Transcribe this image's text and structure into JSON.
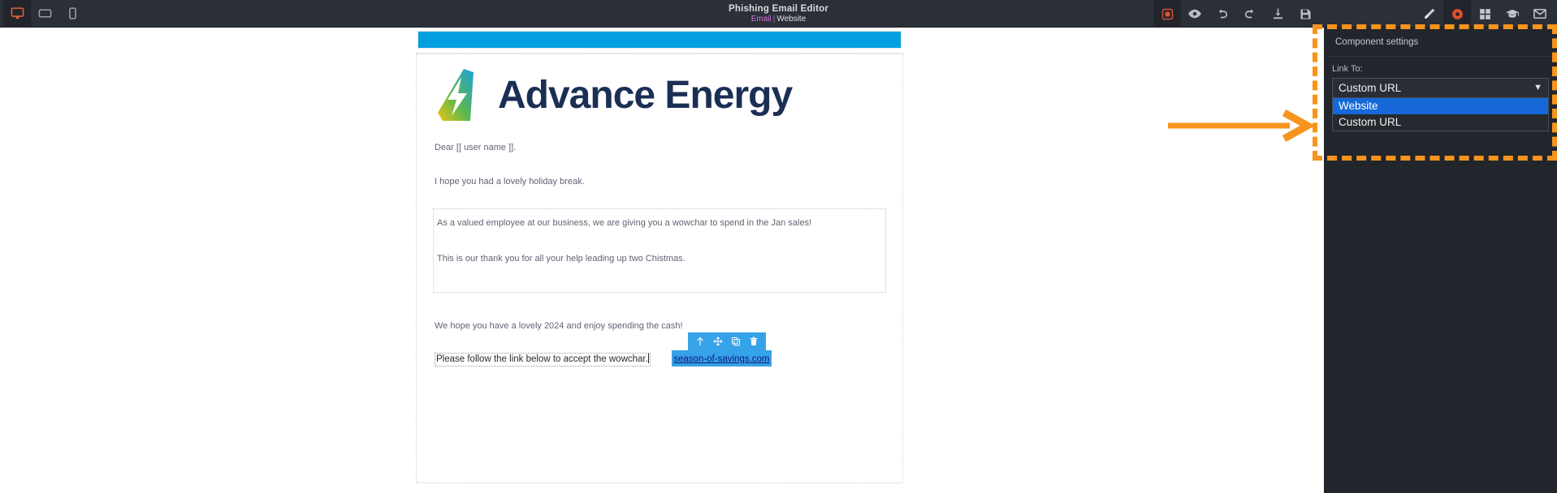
{
  "topbar": {
    "title": "Phishing Email Editor",
    "subtitle": {
      "email": "Email",
      "separator": "|",
      "website": "Website"
    },
    "device_buttons": [
      {
        "name": "desktop-view",
        "label": "Desktop",
        "active": true
      },
      {
        "name": "tablet-view",
        "label": "Tablet",
        "active": false
      },
      {
        "name": "mobile-view",
        "label": "Mobile",
        "active": false
      }
    ],
    "mid_buttons": [
      {
        "name": "borders-toggle",
        "label": "Toggle Borders",
        "active": true
      },
      {
        "name": "preview",
        "label": "Preview"
      },
      {
        "name": "undo",
        "label": "Undo"
      },
      {
        "name": "redo",
        "label": "Redo"
      },
      {
        "name": "import",
        "label": "Import"
      },
      {
        "name": "save",
        "label": "Save"
      }
    ],
    "right_buttons": [
      {
        "name": "style-manager",
        "label": "Style Manager",
        "active": false
      },
      {
        "name": "settings",
        "label": "Settings",
        "active": true
      },
      {
        "name": "layer-blocks",
        "label": "Blocks",
        "active": false
      },
      {
        "name": "training",
        "label": "Training",
        "active": false
      },
      {
        "name": "email",
        "label": "Email",
        "active": false
      }
    ]
  },
  "email": {
    "hero_bar_color": "#029fe0",
    "logo_text": "Advance Energy",
    "paragraphs": {
      "dear": "Dear [[ user name ]].",
      "hope": "I hope you had a lovely holiday break.",
      "valued": "As a valued employee at our business, we are giving you a wowchar to spend in the Jan sales!",
      "thanks": "This is our thank you for all your help leading up two Chistmas.",
      "cash": "We hope you have a lovely 2024 and enjoy spending the cash!",
      "follow": "Please follow the link below to accept the wowchar."
    },
    "link": {
      "text": "season-of-savings.com"
    },
    "component_toolbar": [
      {
        "name": "select-parent-icon",
        "label": "Select parent"
      },
      {
        "name": "move-icon",
        "label": "Move"
      },
      {
        "name": "copy-icon",
        "label": "Copy"
      },
      {
        "name": "delete-icon",
        "label": "Delete"
      }
    ]
  },
  "panel": {
    "header": "Component settings",
    "link_to_label": "Link To:",
    "link_to_value": "Custom URL",
    "link_to_options": [
      {
        "label": "Website",
        "selected": true
      },
      {
        "label": "Custom URL",
        "selected": false
      }
    ]
  },
  "annotation": {
    "color": "#f7941d"
  }
}
